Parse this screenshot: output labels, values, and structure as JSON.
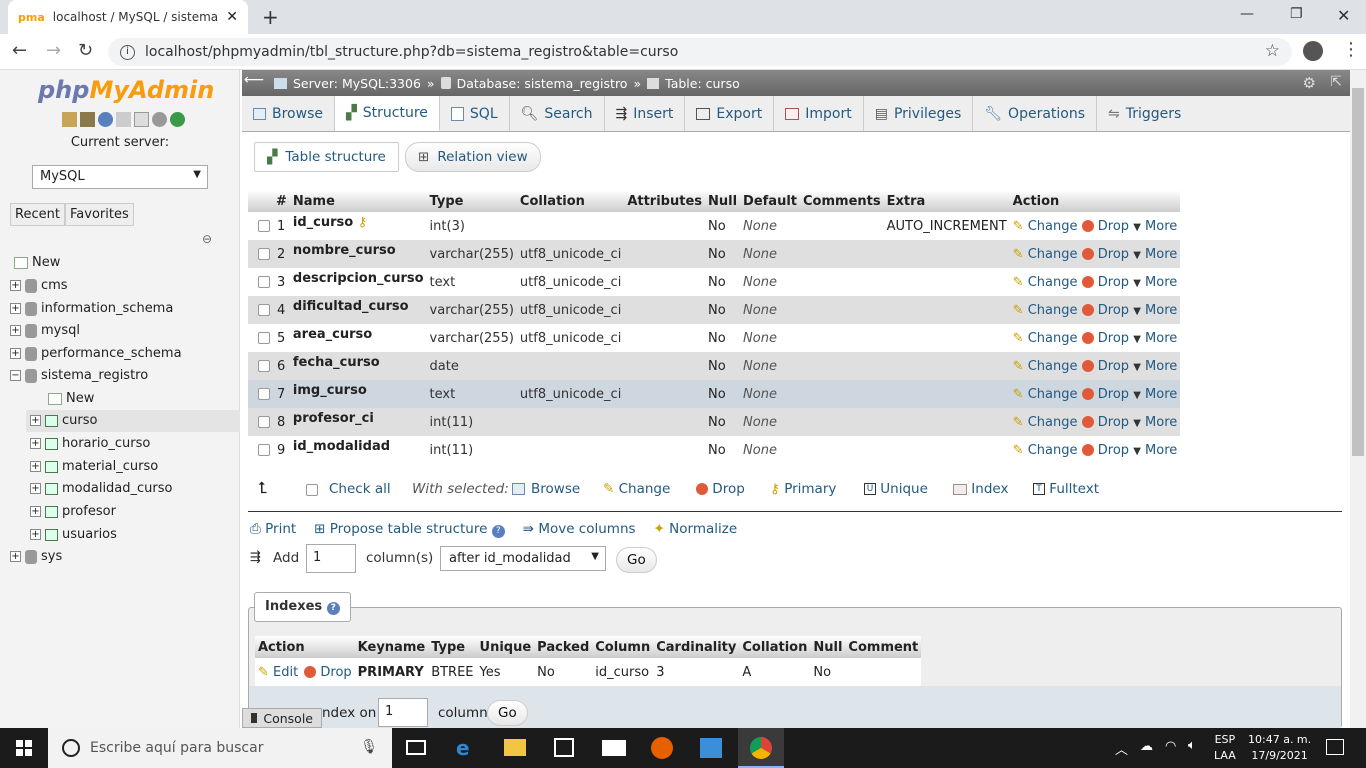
{
  "browser": {
    "tab_title": "localhost / MySQL / sistema_regi",
    "url": "localhost/phpmyadmin/tbl_structure.php?db=sistema_registro&table=curso"
  },
  "nav": {
    "logo_main": "php",
    "logo_accent": "MyAdmin",
    "current_server_label": "Current server:",
    "server_select": "MySQL",
    "recent": "Recent",
    "favorites": "Favorites",
    "tree": [
      {
        "label": "New",
        "level": 0,
        "icon": "new"
      },
      {
        "label": "cms",
        "level": 0,
        "icon": "db"
      },
      {
        "label": "information_schema",
        "level": 0,
        "icon": "db"
      },
      {
        "label": "mysql",
        "level": 0,
        "icon": "db"
      },
      {
        "label": "performance_schema",
        "level": 0,
        "icon": "db"
      },
      {
        "label": "sistema_registro",
        "level": 0,
        "icon": "db",
        "open": true
      },
      {
        "label": "New",
        "level": 1,
        "icon": "new"
      },
      {
        "label": "curso",
        "level": 1,
        "icon": "table",
        "active": true
      },
      {
        "label": "horario_curso",
        "level": 1,
        "icon": "table"
      },
      {
        "label": "material_curso",
        "level": 1,
        "icon": "table"
      },
      {
        "label": "modalidad_curso",
        "level": 1,
        "icon": "table"
      },
      {
        "label": "profesor",
        "level": 1,
        "icon": "table"
      },
      {
        "label": "usuarios",
        "level": 1,
        "icon": "table"
      },
      {
        "label": "sys",
        "level": 0,
        "icon": "db"
      }
    ]
  },
  "breadcrumb": {
    "server": "Server: MySQL:3306",
    "database": "Database: sistema_registro",
    "table": "Table: curso"
  },
  "tabs": [
    "Browse",
    "Structure",
    "SQL",
    "Search",
    "Insert",
    "Export",
    "Import",
    "Privileges",
    "Operations",
    "Triggers"
  ],
  "subtabs": {
    "structure": "Table structure",
    "relation": "Relation view"
  },
  "columns_header": [
    "#",
    "Name",
    "Type",
    "Collation",
    "Attributes",
    "Null",
    "Default",
    "Comments",
    "Extra",
    "Action"
  ],
  "rows": [
    {
      "n": "1",
      "name": "id_curso",
      "type": "int(3)",
      "collation": "",
      "null": "No",
      "default": "None",
      "extra": "AUTO_INCREMENT",
      "key": true
    },
    {
      "n": "2",
      "name": "nombre_curso",
      "type": "varchar(255)",
      "collation": "utf8_unicode_ci",
      "null": "No",
      "default": "None",
      "extra": ""
    },
    {
      "n": "3",
      "name": "descripcion_curso",
      "type": "text",
      "collation": "utf8_unicode_ci",
      "null": "No",
      "default": "None",
      "extra": ""
    },
    {
      "n": "4",
      "name": "dificultad_curso",
      "type": "varchar(255)",
      "collation": "utf8_unicode_ci",
      "null": "No",
      "default": "None",
      "extra": ""
    },
    {
      "n": "5",
      "name": "area_curso",
      "type": "varchar(255)",
      "collation": "utf8_unicode_ci",
      "null": "No",
      "default": "None",
      "extra": ""
    },
    {
      "n": "6",
      "name": "fecha_curso",
      "type": "date",
      "collation": "",
      "null": "No",
      "default": "None",
      "extra": ""
    },
    {
      "n": "7",
      "name": "img_curso",
      "type": "text",
      "collation": "utf8_unicode_ci",
      "null": "No",
      "default": "None",
      "extra": ""
    },
    {
      "n": "8",
      "name": "profesor_ci",
      "type": "int(11)",
      "collation": "",
      "null": "No",
      "default": "None",
      "extra": ""
    },
    {
      "n": "9",
      "name": "id_modalidad",
      "type": "int(11)",
      "collation": "",
      "null": "No",
      "default": "None",
      "extra": ""
    }
  ],
  "row_actions": {
    "change": "Change",
    "drop": "Drop",
    "more": "More"
  },
  "bulk": {
    "check_all": "Check all",
    "with_selected": "With selected:",
    "actions": [
      "Browse",
      "Change",
      "Drop",
      "Primary",
      "Unique",
      "Index",
      "Fulltext"
    ]
  },
  "tools": {
    "print": "Print",
    "propose": "Propose table structure",
    "move": "Move columns",
    "normalize": "Normalize",
    "add": "Add",
    "add_count": "1",
    "columns_label": "column(s)",
    "position": "after id_modalidad",
    "go": "Go"
  },
  "indexes": {
    "title": "Indexes",
    "header": [
      "Action",
      "Keyname",
      "Type",
      "Unique",
      "Packed",
      "Column",
      "Cardinality",
      "Collation",
      "Null",
      "Comment"
    ],
    "row": {
      "edit": "Edit",
      "drop": "Drop",
      "keyname": "PRIMARY",
      "type": "BTREE",
      "unique": "Yes",
      "packed": "No",
      "column": "id_curso",
      "cardinality": "3",
      "collation": "A",
      "null": "No",
      "comment": ""
    },
    "create_label": "ndex on",
    "create_count": "1",
    "create_columns": "columns",
    "go": "Go"
  },
  "console": "Console",
  "taskbar": {
    "search_placeholder": "Escribe aquí para buscar",
    "lang1": "ESP",
    "lang2": "LAA",
    "time": "10:47 a. m.",
    "date": "17/9/2021"
  }
}
